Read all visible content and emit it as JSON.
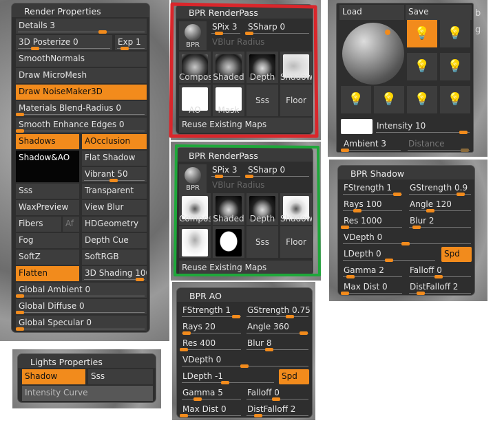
{
  "render_props": {
    "title": "Render Properties",
    "details": "Details 3",
    "posterize": "3D Posterize 0",
    "exp": "Exp 1",
    "smooth_normals": "SmoothNormals",
    "draw_micromesh": "Draw MicroMesh",
    "draw_noisemaker": "Draw NoiseMaker3D",
    "materials_blend": "Materials Blend-Radius 0",
    "smooth_enhance": "Smooth Enhance Edges 0",
    "shadows": "Shadows",
    "aocclusion": "AOcclusion",
    "shadow_ao": "Shadow&AO",
    "flat_shadow": "Flat Shadow",
    "vibrant": "Vibrant 50",
    "sss": "Sss",
    "transparent": "Transparent",
    "waxpreview": "WaxPreview",
    "view_blur": "View Blur",
    "fibers": "Fibers",
    "af": "Af",
    "hdgeometry": "HDGeometry",
    "fog": "Fog",
    "depth_cue": "Depth Cue",
    "softz": "SoftZ",
    "softrgb": "SoftRGB",
    "flatten": "Flatten",
    "shading": "3D Shading 100",
    "global_ambient": "Global Ambient 0",
    "global_diffuse": "Global Diffuse 0",
    "global_specular": "Global Specular 0"
  },
  "lights_props": {
    "title": "Lights Properties",
    "shadow": "Shadow",
    "sss": "Sss",
    "intensity_curve": "Intensity Curve"
  },
  "bpr1": {
    "title": "BPR RenderPass",
    "bpr": "BPR",
    "spix": "SPix 3",
    "ssharp": "SSharp 0",
    "vblur": "VBlur Radius",
    "compos": "Compos",
    "shaded": "Shaded",
    "depth": "Depth",
    "shadow": "Shadow",
    "ao": "AO",
    "mask": "Mask",
    "sss": "Sss",
    "floor": "Floor",
    "reuse": "Reuse Existing Maps"
  },
  "bpr2": {
    "title": "BPR RenderPass",
    "bpr": "BPR",
    "spix": "SPix 3",
    "ssharp": "SSharp 0",
    "vblur": "VBlur Radius",
    "compos": "Compos",
    "shaded": "Shaded",
    "depth": "Depth",
    "shadow": "Shadow",
    "sss": "Sss",
    "floor": "Floor",
    "reuse": "Reuse Existing Maps"
  },
  "light": {
    "load": "Load",
    "save": "Save",
    "intensity": "Intensity 10",
    "ambient": "Ambient 3",
    "distance": "Distance",
    "side_b": "b",
    "side_g": "g"
  },
  "bpr_shadow": {
    "title": "BPR Shadow",
    "fstrength": "FStrength 1",
    "gstrength": "GStrength 0.9",
    "rays": "Rays 100",
    "angle": "Angle 120",
    "res": "Res 1000",
    "blur": "Blur 2",
    "vdepth": "VDepth 0",
    "ldepth": "LDepth 0",
    "spd": "Spd",
    "gamma": "Gamma 2",
    "falloff": "Falloff 0",
    "maxdist": "Max Dist 0",
    "distfalloff": "DistFalloff 2"
  },
  "bpr_ao": {
    "title": "BPR AO",
    "fstrength": "FStrength 1",
    "gstrength": "GStrength 0.75",
    "rays": "Rays 20",
    "angle": "Angle 360",
    "res": "Res 400",
    "blur": "Blur 8",
    "vdepth": "VDepth 0",
    "ldepth": "LDepth -1",
    "spd": "Spd",
    "gamma": "Gamma 5",
    "falloff": "Falloff 0",
    "maxdist": "Max Dist 0",
    "distfalloff": "DistFalloff 2"
  },
  "colors": {
    "accent": "#f28b1c",
    "panel": "#2e2e2e",
    "button": "#3d3d3d",
    "annotation_red": "#d9262b",
    "annotation_green": "#1ea83a"
  },
  "icons": {
    "bulb": "lightbulb-icon",
    "material": "material-sphere-icon"
  }
}
